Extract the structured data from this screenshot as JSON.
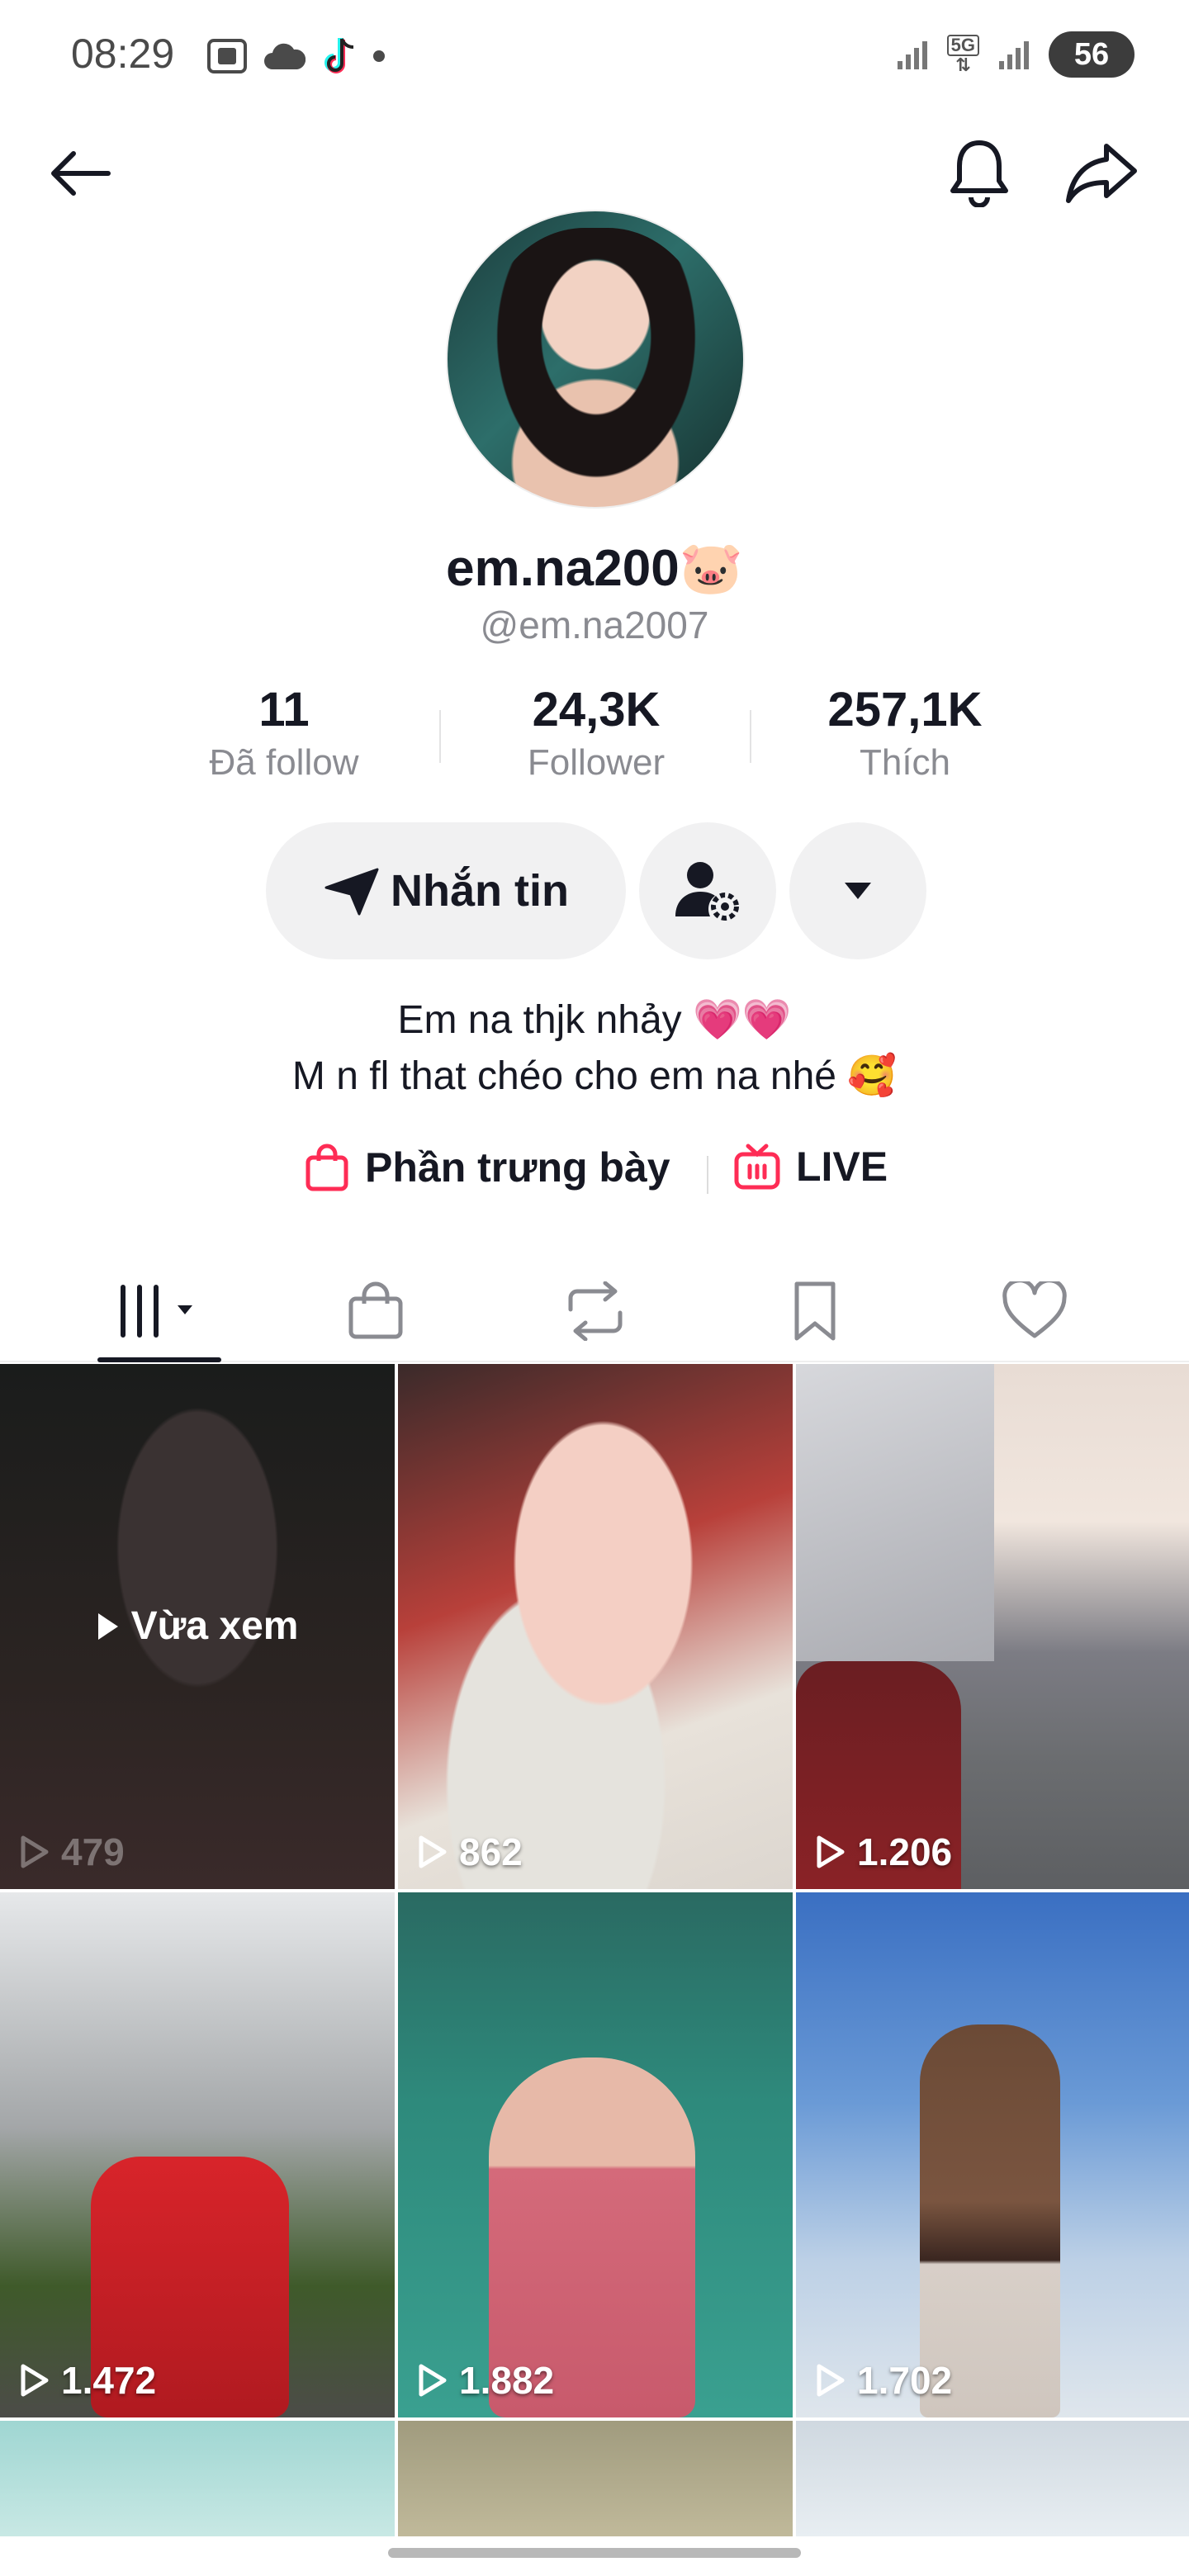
{
  "status_bar": {
    "time": "08:29",
    "network": "5G",
    "battery": "56"
  },
  "profile": {
    "display_name": "em.na200🐷",
    "username": "@em.na2007"
  },
  "stats": {
    "following": {
      "value": "11",
      "label": "Đã follow"
    },
    "followers": {
      "value": "24,3K",
      "label": "Follower"
    },
    "likes": {
      "value": "257,1K",
      "label": "Thích"
    }
  },
  "actions": {
    "message_label": "Nhắn tin"
  },
  "bio": {
    "line1": "Em na thjk nhảy 💗💗",
    "line2": "M n fl that chéo cho em na nhé 🥰"
  },
  "links": {
    "showcase": "Phần trưng bày",
    "live": "LIVE"
  },
  "tabs": [
    "videos",
    "showcase",
    "reposts",
    "favorites",
    "liked"
  ],
  "videos": [
    {
      "views": "479",
      "watched_label": "Vừa xem"
    },
    {
      "views": "862"
    },
    {
      "views": "1.206"
    },
    {
      "views": "1.472"
    },
    {
      "views": "1.882"
    },
    {
      "views": "1.702"
    }
  ],
  "colors": {
    "accent": "#fe2c55",
    "text": "#161823",
    "muted": "#8a8b91"
  }
}
